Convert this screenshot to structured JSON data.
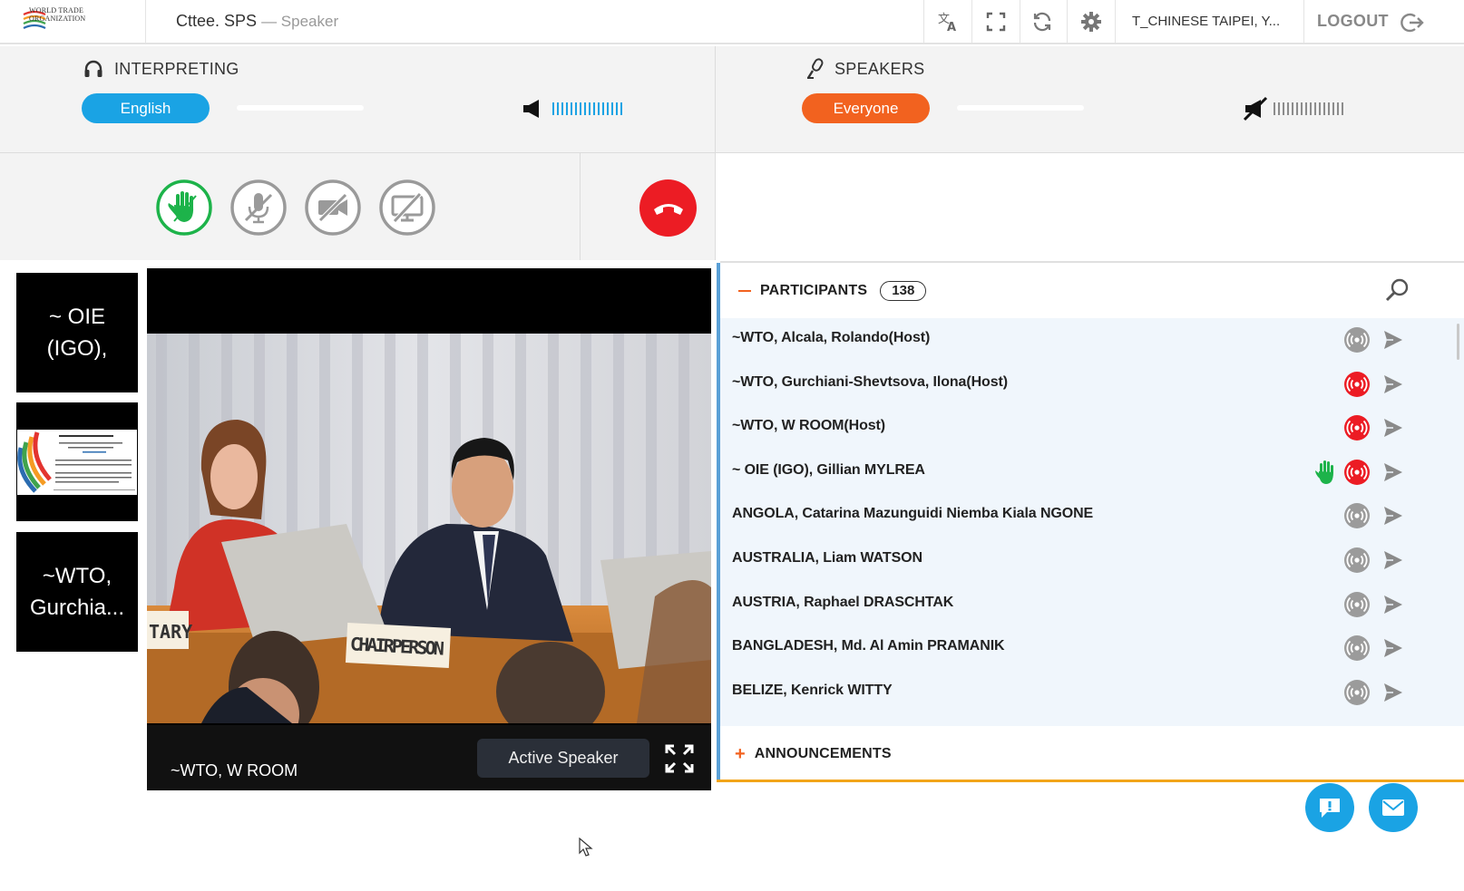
{
  "header": {
    "logo_text": "WORLD TRADE\nORGANIZATION",
    "meeting": "Cttee. SPS",
    "role": "— Speaker",
    "user": "T_CHINESE TAIPEI, Y...",
    "logout_label": "LOGOUT",
    "icons": [
      "translate-icon",
      "fullscreen-icon",
      "refresh-icon",
      "gear-icon",
      "logout-icon"
    ]
  },
  "interpreting": {
    "label": "INTERPRETING",
    "language": "English"
  },
  "speakers": {
    "label": "SPEAKERS",
    "channel": "Everyone"
  },
  "controls": [
    "raise-hand",
    "microphone-muted",
    "camera-off",
    "screen-share-off",
    "hang-up"
  ],
  "thumbnails": [
    {
      "label": "~ OIE (IGO),"
    },
    {
      "label": "~WTO, Gurchia..."
    }
  ],
  "video": {
    "speaker": "~WTO, W ROOM",
    "active_label": "Active Speaker",
    "placards": {
      "left": "TARY",
      "center": "CHAIRPERSON"
    }
  },
  "participants": {
    "label": "PARTICIPANTS",
    "count": "138",
    "list": [
      {
        "name": "~WTO, Alcala, Rolando(Host)",
        "speaking": false,
        "hand": false
      },
      {
        "name": "~WTO, Gurchiani-Shevtsova, Ilona(Host)",
        "speaking": true,
        "hand": false
      },
      {
        "name": "~WTO, W ROOM(Host)",
        "speaking": true,
        "hand": false
      },
      {
        "name": "~ OIE (IGO), Gillian MYLREA",
        "speaking": true,
        "hand": true
      },
      {
        "name": "ANGOLA, Catarina Mazunguidi Niemba Kiala NGONE",
        "speaking": false,
        "hand": false
      },
      {
        "name": "AUSTRALIA, Liam WATSON",
        "speaking": false,
        "hand": false
      },
      {
        "name": "AUSTRIA, Raphael DRASCHTAK",
        "speaking": false,
        "hand": false
      },
      {
        "name": "BANGLADESH, Md. Al Amin PRAMANIK",
        "speaking": false,
        "hand": false
      },
      {
        "name": "BELIZE, Kenrick WITTY",
        "speaking": false,
        "hand": false
      }
    ]
  },
  "announcements": {
    "label": "ANNOUNCEMENTS"
  },
  "colors": {
    "blue": "#1aa3e4",
    "orange": "#f2621f",
    "red": "#ec1c24",
    "green": "#1db34a"
  }
}
